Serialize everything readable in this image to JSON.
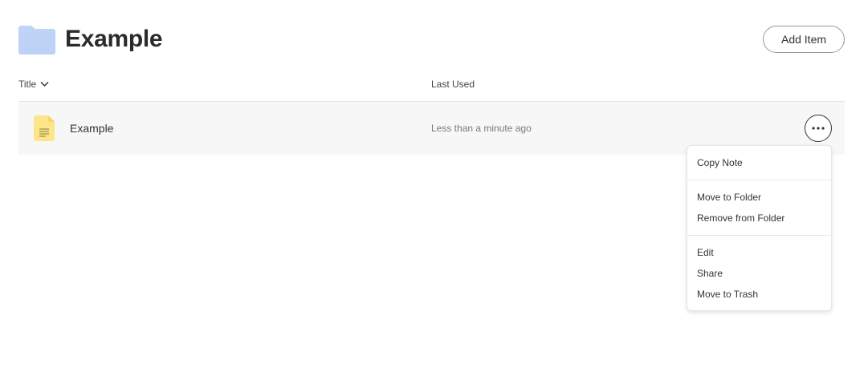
{
  "header": {
    "title": "Example",
    "folder_icon": "folder-icon",
    "folder_color": "#c0d4f7",
    "add_item_label": "Add Item"
  },
  "columns": {
    "title_label": "Title",
    "last_used_label": "Last Used",
    "sort_icon": "chevron-down-icon"
  },
  "rows": [
    {
      "title": "Example",
      "last_used": "Less than a minute ago",
      "icon": "note-icon",
      "icon_color": "#fde68a"
    }
  ],
  "menu": {
    "groups": [
      [
        "Copy Note"
      ],
      [
        "Move to Folder",
        "Remove from Folder"
      ],
      [
        "Edit",
        "Share",
        "Move to Trash"
      ]
    ]
  }
}
